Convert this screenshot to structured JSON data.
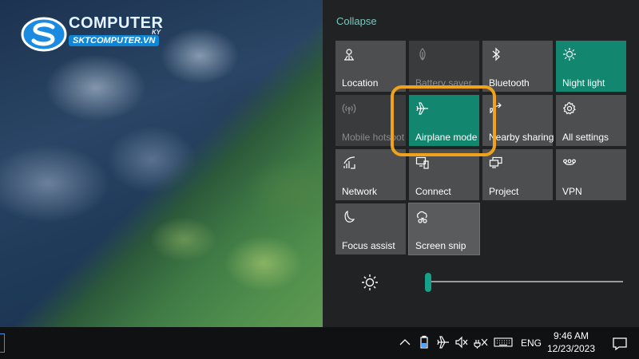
{
  "logo": {
    "word": "COMPUTER",
    "superscript": "KY",
    "url": "SKTCOMPUTER.VN"
  },
  "action_center": {
    "collapse_label": "Collapse",
    "tiles": [
      {
        "label": "Location",
        "icon": "location-icon",
        "state": "default"
      },
      {
        "label": "Battery saver",
        "icon": "battery-saver-icon",
        "state": "disabled"
      },
      {
        "label": "Bluetooth",
        "icon": "bluetooth-icon",
        "state": "default"
      },
      {
        "label": "Night light",
        "icon": "night-light-icon",
        "state": "on"
      },
      {
        "label": "Mobile hotspot",
        "icon": "mobile-hotspot-icon",
        "state": "disabled"
      },
      {
        "label": "Airplane mode",
        "icon": "airplane-icon",
        "state": "on"
      },
      {
        "label": "Nearby sharing",
        "icon": "nearby-sharing-icon",
        "state": "default"
      },
      {
        "label": "All settings",
        "icon": "gear-icon",
        "state": "default"
      },
      {
        "label": "Network",
        "icon": "network-icon",
        "state": "default"
      },
      {
        "label": "Connect",
        "icon": "connect-icon",
        "state": "default"
      },
      {
        "label": "Project",
        "icon": "project-icon",
        "state": "default"
      },
      {
        "label": "VPN",
        "icon": "vpn-icon",
        "state": "default"
      },
      {
        "label": "Focus assist",
        "icon": "moon-icon",
        "state": "default"
      },
      {
        "label": "Screen snip",
        "icon": "screen-snip-icon",
        "state": "default"
      }
    ],
    "brightness": {
      "value": 0.0,
      "icon": "sun-icon"
    }
  },
  "taskbar": {
    "tray_icons": [
      "chevron-up-icon",
      "battery-icon",
      "airplane-icon",
      "volume-muted-icon",
      "power-plug-icon",
      "keyboard-icon"
    ],
    "language": "ENG",
    "time": "9:46 AM",
    "date": "12/23/2023",
    "notification_icon": "notification-icon"
  },
  "colors": {
    "accent": "#12866f",
    "highlight": "#f0a21a",
    "tile": "#4d4e4f",
    "panel": "#212223"
  }
}
